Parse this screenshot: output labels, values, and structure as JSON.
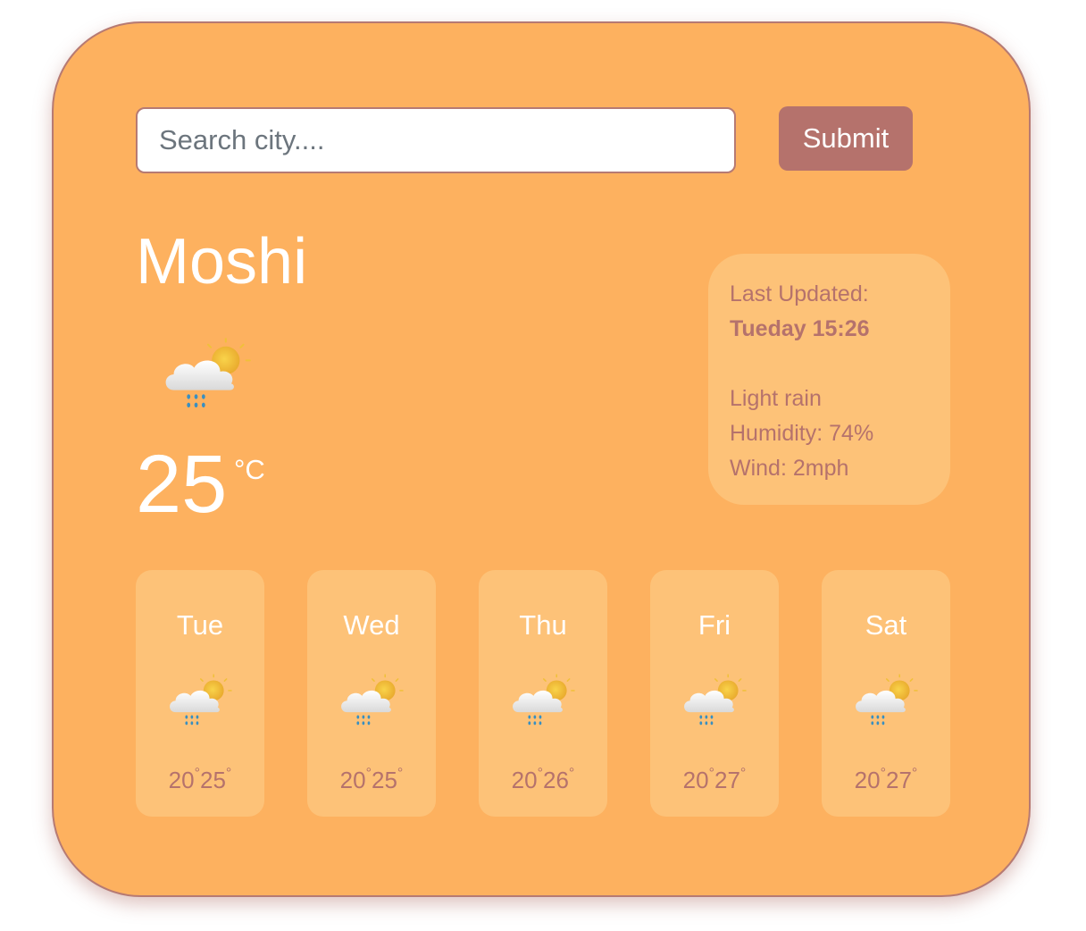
{
  "search": {
    "placeholder": "Search city....",
    "value": "",
    "submit_label": "Submit"
  },
  "current": {
    "city": "Moshi",
    "icon": "cloud-sun-rain-icon",
    "temperature": "25",
    "unit": "°C"
  },
  "details": {
    "last_updated_label": "Last Updated:",
    "last_updated_value": "Tueday 15:26",
    "description": "Light rain",
    "humidity": "Humidity: 74%",
    "wind": "Wind: 2mph"
  },
  "forecast": [
    {
      "day": "Tue",
      "min": "20",
      "max": "25",
      "icon": "cloud-sun-rain-icon"
    },
    {
      "day": "Wed",
      "min": "20",
      "max": "25",
      "icon": "cloud-sun-rain-icon"
    },
    {
      "day": "Thu",
      "min": "20",
      "max": "26",
      "icon": "cloud-sun-rain-icon"
    },
    {
      "day": "Fri",
      "min": "20",
      "max": "27",
      "icon": "cloud-sun-rain-icon"
    },
    {
      "day": "Sat",
      "min": "20",
      "max": "27",
      "icon": "cloud-sun-rain-icon"
    }
  ],
  "degree_symbol": "°",
  "colors": {
    "card_background": "#fdb15f",
    "panel_background": "#fdc278",
    "accent": "#b5726c",
    "text_light": "#ffffff"
  }
}
